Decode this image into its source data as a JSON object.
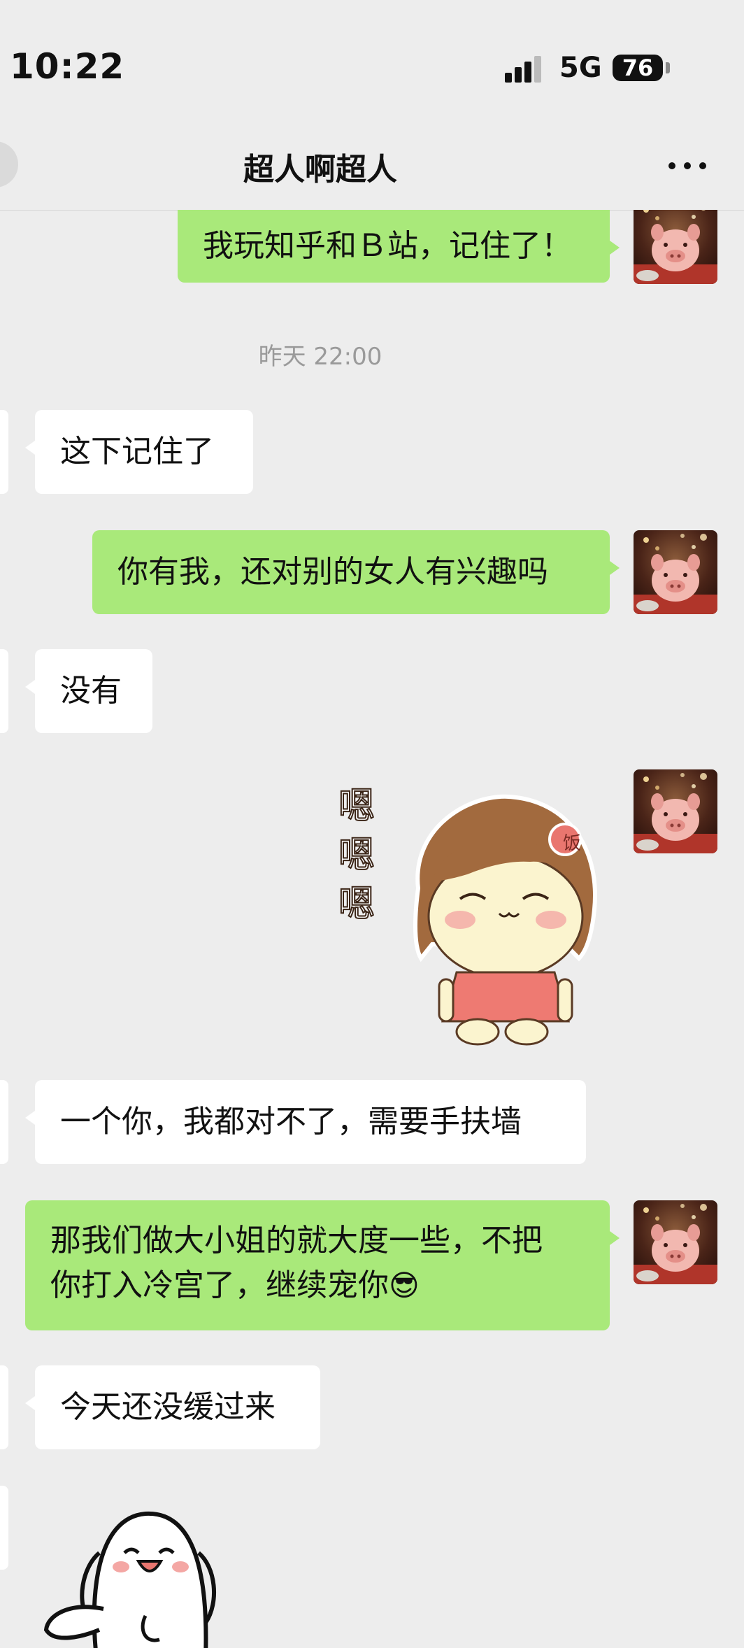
{
  "status_bar": {
    "time": "10:22",
    "network": "5G",
    "battery": "76"
  },
  "header": {
    "title": "超人啊超人"
  },
  "chat": {
    "messages": [
      {
        "sender": "me",
        "text": "我玩知乎和Ｂ站，记住了！"
      },
      {
        "type": "timestamp",
        "text": "昨天 22:00"
      },
      {
        "sender": "other",
        "text": "这下记住了"
      },
      {
        "sender": "me",
        "text": "你有我，还对别的女人有兴趣吗"
      },
      {
        "sender": "other",
        "text": "没有"
      },
      {
        "sender": "me",
        "type": "sticker",
        "sticker_text": [
          "嗯",
          "嗯",
          "嗯"
        ],
        "badge": "饭"
      },
      {
        "sender": "other",
        "text": "一个你，我都对不了，需要手扶墙"
      },
      {
        "sender": "me",
        "line1": "那我们做大小姐的就大度一些，不把",
        "line2": "你打入冷宫了，继续宠你",
        "emoji": "😎"
      },
      {
        "sender": "other",
        "text": "今天还没缓过来"
      },
      {
        "sender": "other",
        "type": "sticker"
      }
    ]
  },
  "colors": {
    "background": "#ededed",
    "my_bubble": "#a9e97a",
    "other_bubble": "#ffffff"
  },
  "icons": [
    "back-icon",
    "more-icon",
    "signal-icon",
    "battery-icon"
  ]
}
